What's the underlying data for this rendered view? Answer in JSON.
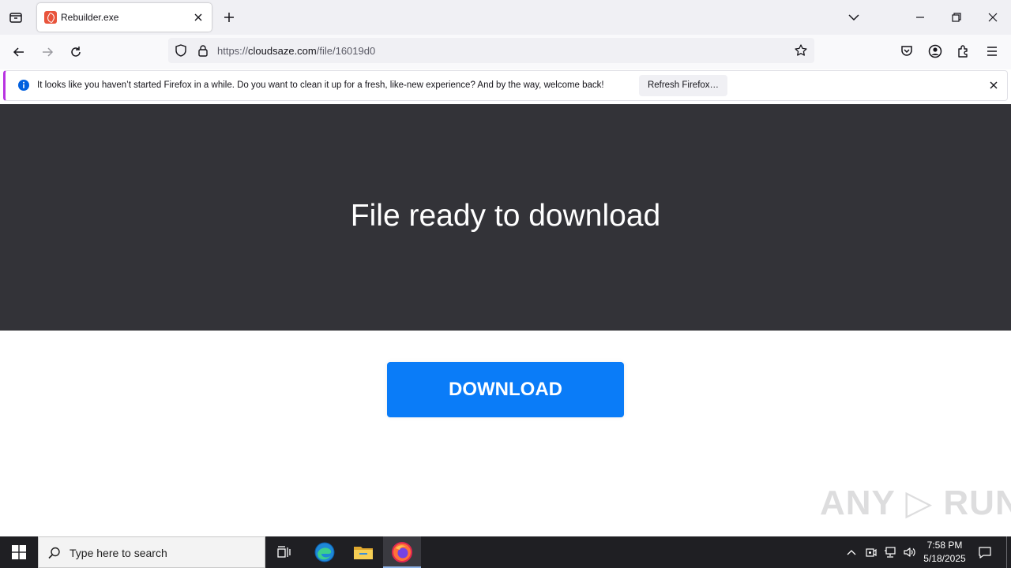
{
  "browser": {
    "tab_title": "Rebuilder.exe",
    "url_prefix": "https://",
    "url_host": "cloudsaze.com",
    "url_path": "/file/16019d0"
  },
  "notification": {
    "message": "It looks like you haven’t started Firefox in a while. Do you want to clean it up for a fresh, like-new experience? And by the way, welcome back!",
    "button_label": "Refresh Firefox…"
  },
  "page": {
    "headline": "File ready to download",
    "download_label": "DOWNLOAD"
  },
  "watermark": "ANY ▷ RUN",
  "taskbar": {
    "search_placeholder": "Type here to search",
    "time": "7:58 PM",
    "date": "5/18/2025"
  },
  "icons": {
    "tabstrip": [
      "tab-list-icon",
      "tab-favicon",
      "tab-close-icon",
      "new-tab-icon",
      "list-all-tabs-icon",
      "minimize-icon",
      "restore-icon",
      "close-window-icon"
    ],
    "navbar": [
      "back-icon",
      "forward-icon",
      "reload-icon",
      "shield-icon",
      "lock-icon",
      "bookmark-star-icon",
      "pocket-icon",
      "account-icon",
      "extensions-icon",
      "menu-icon"
    ],
    "taskbar": [
      "windows-start-icon",
      "search-icon",
      "task-view-icon",
      "edge-icon",
      "file-explorer-icon",
      "firefox-icon",
      "chevron-up-icon",
      "meet-icon",
      "network-icon",
      "volume-icon",
      "notification-icon"
    ]
  },
  "colors": {
    "hero_bg": "#333338",
    "download_button": "#0a7cf8",
    "notification_accent": "#b833e1",
    "taskbar_bg": "#1f1f23"
  }
}
